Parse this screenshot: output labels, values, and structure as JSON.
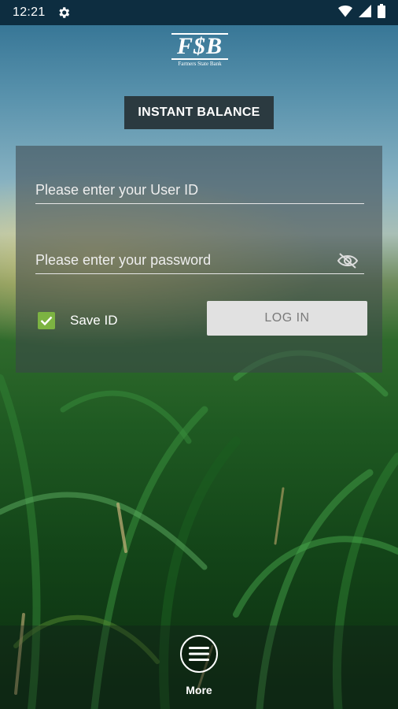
{
  "status_bar": {
    "time": "12:21",
    "icons": [
      "gear-icon",
      "wifi-icon",
      "signal-icon",
      "battery-icon"
    ]
  },
  "logo": {
    "mark": "F$B",
    "subtitle": "Farmers State Bank"
  },
  "instant_balance": {
    "label": "INSTANT BALANCE"
  },
  "login_form": {
    "user_id": {
      "placeholder": "Please enter your User ID",
      "value": ""
    },
    "password": {
      "placeholder": "Please enter your password",
      "value": ""
    },
    "save_id": {
      "label": "Save ID",
      "checked": true
    },
    "login_button": {
      "label": "LOG IN"
    }
  },
  "bottom_nav": {
    "more": {
      "label": "More",
      "icon": "menu-icon"
    }
  },
  "colors": {
    "status_bar": "#0d2d40",
    "instant_button": "#2b3a40",
    "checkbox": "#7cb342",
    "login_button": "#e1e1e1"
  }
}
